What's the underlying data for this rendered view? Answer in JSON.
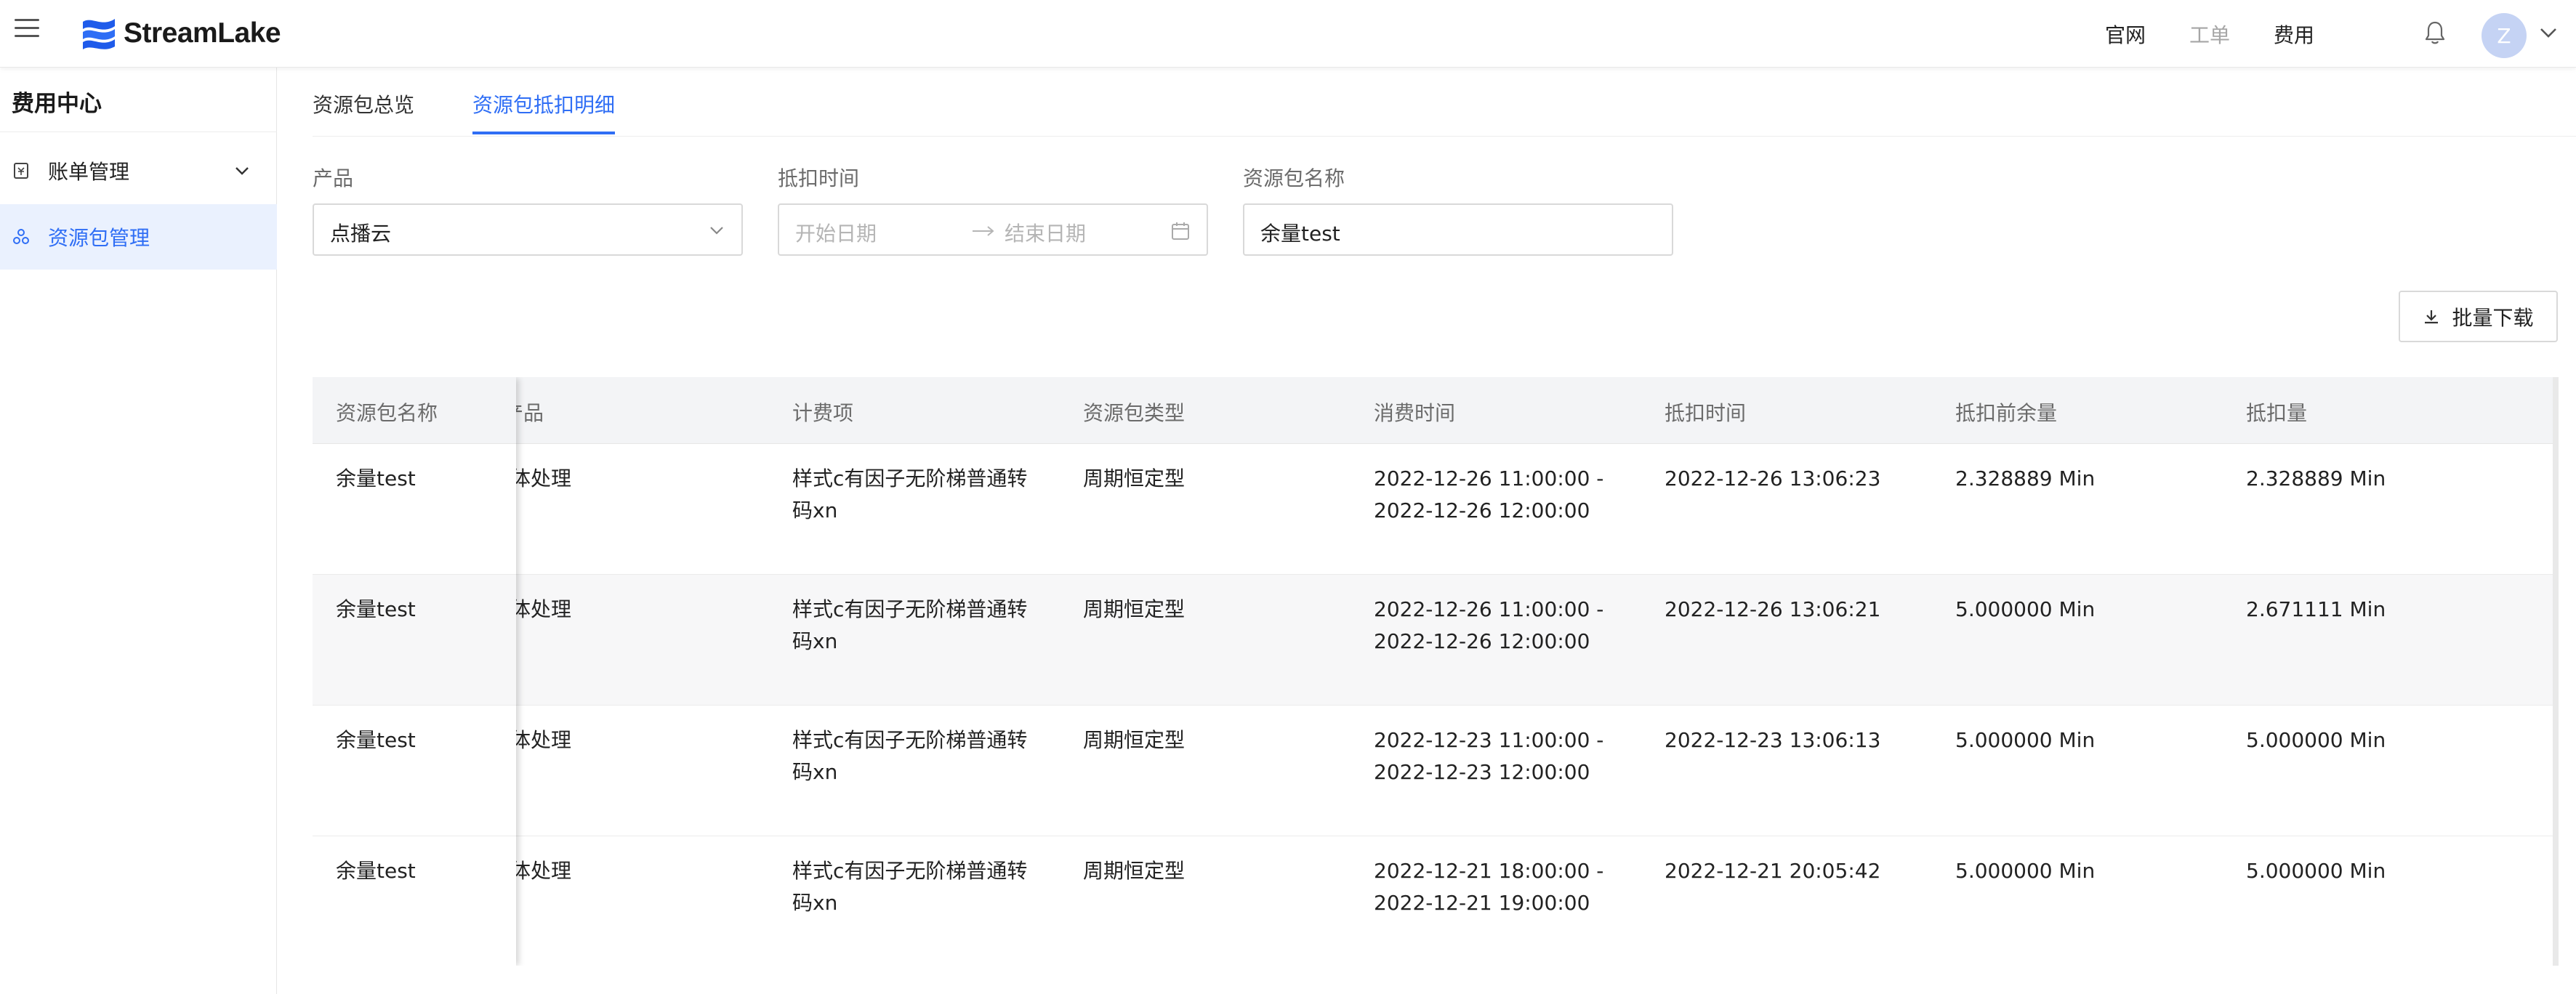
{
  "header": {
    "logo_text": "StreamLake",
    "nav": [
      {
        "label": "官网",
        "muted": false
      },
      {
        "label": "工单",
        "muted": true
      },
      {
        "label": "费用",
        "muted": false
      }
    ],
    "avatar_letter": "Z"
  },
  "sidebar": {
    "title": "费用中心",
    "items": [
      {
        "label": "账单管理",
        "icon": "bill-icon",
        "expandable": true,
        "active": false
      },
      {
        "label": "资源包管理",
        "icon": "package-icon",
        "expandable": false,
        "active": true
      }
    ]
  },
  "tabs": [
    {
      "label": "资源包总览",
      "active": false
    },
    {
      "label": "资源包抵扣明细",
      "active": true
    }
  ],
  "filters": {
    "product": {
      "label": "产品",
      "value": "点播云"
    },
    "deduct_time": {
      "label": "抵扣时间",
      "start_placeholder": "开始日期",
      "end_placeholder": "结束日期"
    },
    "package_name": {
      "label": "资源包名称",
      "value": "余量test"
    }
  },
  "actions": {
    "batch_download": "批量下载"
  },
  "table": {
    "columns": [
      "资源包名称",
      "产品",
      "计费项",
      "资源包类型",
      "消费时间",
      "抵扣时间",
      "抵扣前余量",
      "抵扣量"
    ],
    "product_partial_header": "产品",
    "rows": [
      {
        "name": "余量test",
        "product": "媒体处理",
        "product_visible": "体处理",
        "billing_item_1": "样式c有因子无阶梯普通转",
        "billing_item_2": "码xn",
        "type": "周期恒定型",
        "consume_start": "2022-12-26 11:00:00 -",
        "consume_end": "2022-12-26 12:00:00",
        "deduct_time": "2022-12-26 13:06:23",
        "before": "2.328889 Min",
        "amount": "2.328889 Min"
      },
      {
        "name": "余量test",
        "product": "媒体处理",
        "product_visible": "体处理",
        "billing_item_1": "样式c有因子无阶梯普通转",
        "billing_item_2": "码xn",
        "type": "周期恒定型",
        "consume_start": "2022-12-26 11:00:00 -",
        "consume_end": "2022-12-26 12:00:00",
        "deduct_time": "2022-12-26 13:06:21",
        "before": "5.000000 Min",
        "amount": "2.671111 Min"
      },
      {
        "name": "余量test",
        "product": "媒体处理",
        "product_visible": "体处理",
        "billing_item_1": "样式c有因子无阶梯普通转",
        "billing_item_2": "码xn",
        "type": "周期恒定型",
        "consume_start": "2022-12-23 11:00:00 -",
        "consume_end": "2022-12-23 12:00:00",
        "deduct_time": "2022-12-23 13:06:13",
        "before": "5.000000 Min",
        "amount": "5.000000 Min"
      },
      {
        "name": "余量test",
        "product": "媒体处理",
        "product_visible": "体处理",
        "billing_item_1": "样式c有因子无阶梯普通转",
        "billing_item_2": "码xn",
        "type": "周期恒定型",
        "consume_start": "2022-12-21 18:00:00 -",
        "consume_end": "2022-12-21 19:00:00",
        "deduct_time": "2022-12-21 20:05:42",
        "before": "5.000000 Min",
        "amount": "5.000000 Min"
      }
    ]
  },
  "colors": {
    "accent": "#2f6ef5",
    "active_bg": "#eaf1fe",
    "header_bg": "#f3f4f6"
  }
}
